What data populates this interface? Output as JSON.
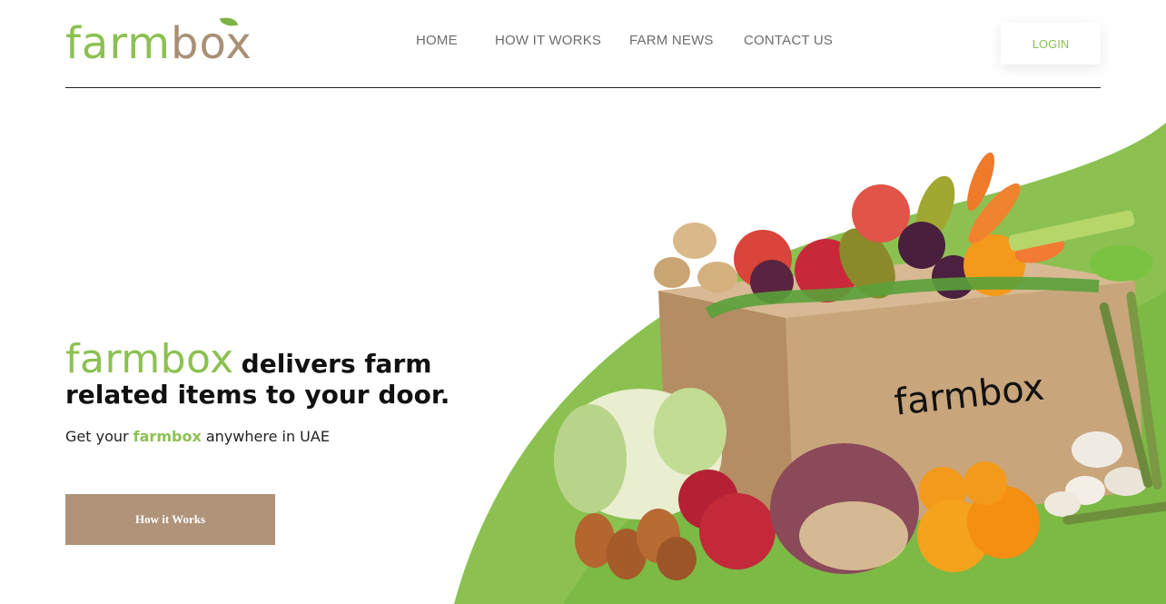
{
  "brand": {
    "part1": "farm",
    "part2": "box",
    "colors": {
      "green": "#8cc152",
      "brown": "#a98f74",
      "button": "#b0947a"
    }
  },
  "nav": {
    "items": [
      {
        "label": "HOME"
      },
      {
        "label": "HOW IT WORKS"
      },
      {
        "label": "FARM NEWS"
      },
      {
        "label": "CONTACT US"
      }
    ],
    "login_label": "LOGIN"
  },
  "hero": {
    "headline_brand": "farmbox",
    "headline_line1": "delivers farm",
    "headline_line2": "related items to your door.",
    "sub_prefix": "Get your ",
    "sub_brand": "farmbox",
    "sub_suffix": " anywhere in UAE",
    "cta_label": "How it Works",
    "box_label": "farmbox"
  }
}
